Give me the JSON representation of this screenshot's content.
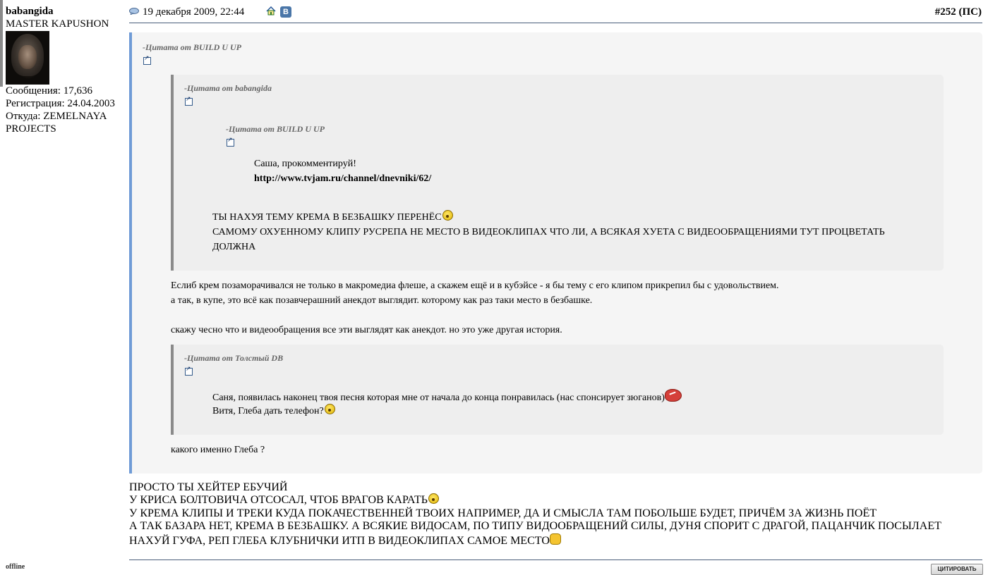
{
  "user": {
    "name": "babangida",
    "title": "MASTER KAPUSHON",
    "posts_label": "Сообщения: 17,636",
    "registered_label": "Регистрация: 24.04.2003",
    "from_label_line1": "Откуда: ZEMELNAYA",
    "from_label_line2": "PROJECTS",
    "status": "offline"
  },
  "post": {
    "date": "19 декабря 2009, 22:44",
    "number": "#252",
    "number_suffix": "(ПС)",
    "icons": [
      "message-icon",
      "home-icon",
      "vk-icon"
    ],
    "vk_letter": "В"
  },
  "quotes": {
    "outer_author": "-Цитата от BUILD U UP",
    "level2_author": "-Цитата от babangida",
    "level3_author": "-Цитата от BUILD U UP",
    "level3_line1": "Саша, прокомментируй!",
    "level3_link": "http://www.tvjam.ru/channel/dnevniki/62/",
    "level2_line1": "ТЫ НАХУЯ ТЕМУ КРЕМА В БЕЗБАШКУ ПЕРЕНЁС",
    "level2_line2": "САМОМУ ОХУЕННОМУ КЛИПУ РУСРЕПА НЕ МЕСТО В ВИДЕОКЛИПАХ ЧТО ЛИ, А ВСЯКАЯ ХУЕТА С ВИДЕООБРАЩЕНИЯМИ ТУТ ПРОЦВЕТАТЬ",
    "level2_line3": "ДОЛЖНА",
    "outer_line1": "Еслиб крем позаморачивался не только в макромедиа флеше, а скажем ещё и в кубэйсе - я бы тему с его клипом прикрепил бы с удовольствием.",
    "outer_line2": "а так, в купе, это всё как позавчерашний анекдот выглядит. которому как раз таки место в безбашке.",
    "outer_line3": "скажу чесно что и видеообращения все эти выглядят как анекдот. но это уже другая история.",
    "level2b_author": "-Цитата от Толстый DB",
    "level2b_line1": "Саня, появилась наконец твоя песня которая мне от начала до конца понравилась (нас спонсирует зюганов)",
    "level2b_line2": "Витя, Глеба дать телефон?",
    "outer_line4": "какого именно Глеба ?"
  },
  "body": {
    "line1": "ПРОСТО ТЫ ХЕЙТЕР ЕБУЧИЙ",
    "line2": "У КРИСА БОЛТОВИЧА ОТСОСАЛ, ЧТОБ ВРАГОВ КАРАТЬ",
    "line3": "У КРЕМА КЛИПЫ И ТРЕКИ КУДА ПОКАЧЕСТВЕННЕЙ ТВОИХ НАПРИМЕР, ДА И СМЫСЛА ТАМ ПОБОЛЬШЕ БУДЕТ, ПРИЧЁМ ЗА ЖИЗНЬ ПОЁТ",
    "line4": "А ТАК БАЗАРА НЕТ, КРЕМА В БЕЗБАШКУ. А ВСЯКИЕ ВИДОСАМ, ПО ТИПУ ВИДООБРАЩЕНИЙ СИЛЫ, ДУНЯ СПОРИТ С ДРАГОЙ, ПАЦАНЧИК ПОСЫЛАЕТ",
    "line5": "НАХУЙ ГУФА, РЕП ГЛЕБА КЛУБНИЧКИ ИТП В ВИДЕОКЛИПАХ САМОЕ МЕСТО"
  },
  "footer": {
    "quote_button": "ЦИТИРОВАТЬ"
  }
}
